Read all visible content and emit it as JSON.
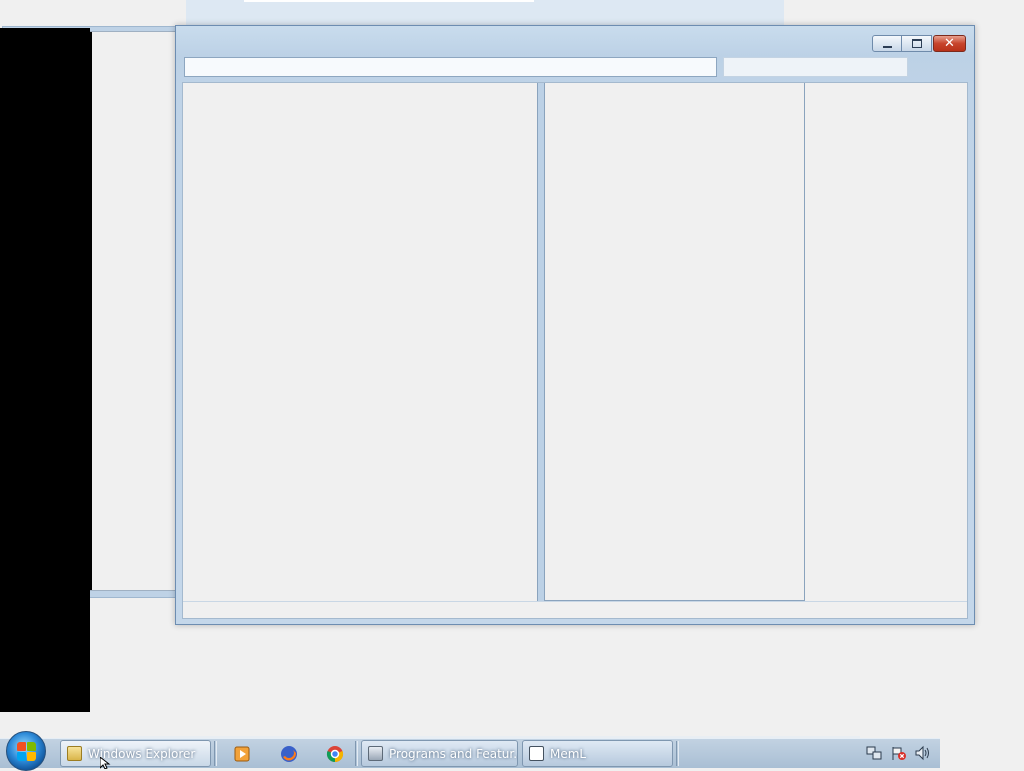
{
  "desktop": {
    "background_color": "#f0f0f0"
  },
  "main_window": {
    "title": "",
    "address_value": "",
    "search_placeholder": "",
    "caption_buttons": {
      "minimize": "minimize-icon",
      "maximize": "maximize-icon",
      "close": "close-icon"
    },
    "colors": {
      "frame": "#bcd1e6",
      "close": "#c7442c"
    }
  },
  "taskbar": {
    "start_icon": "windows-logo-icon",
    "buttons": [
      {
        "label": "Windows Explorer",
        "icon": "explorer-folder-icon",
        "active": true
      },
      {
        "label": "Programs and Featur...",
        "icon": "programs-features-icon",
        "active": false
      },
      {
        "label": "MemL",
        "icon": "app-window-icon",
        "active": false
      }
    ],
    "pinned": [
      {
        "icon": "media-player-icon"
      },
      {
        "icon": "firefox-icon"
      },
      {
        "icon": "chrome-icon"
      }
    ],
    "tray": [
      {
        "icon": "network-icon"
      },
      {
        "icon": "action-center-flag-icon"
      },
      {
        "icon": "volume-icon"
      }
    ]
  }
}
